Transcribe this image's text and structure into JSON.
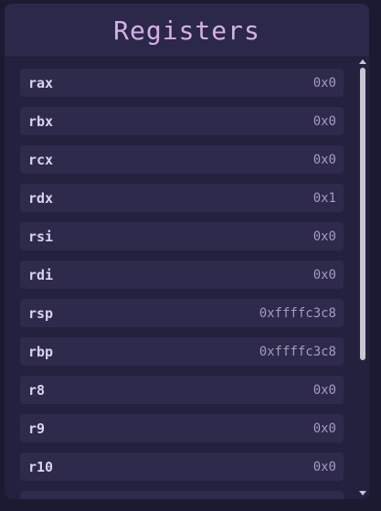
{
  "panel": {
    "title": "Registers"
  },
  "registers": [
    {
      "name": "rax",
      "value": "0x0"
    },
    {
      "name": "rbx",
      "value": "0x0"
    },
    {
      "name": "rcx",
      "value": "0x0"
    },
    {
      "name": "rdx",
      "value": "0x1"
    },
    {
      "name": "rsi",
      "value": "0x0"
    },
    {
      "name": "rdi",
      "value": "0x0"
    },
    {
      "name": "rsp",
      "value": "0xffffc3c8"
    },
    {
      "name": "rbp",
      "value": "0xffffc3c8"
    },
    {
      "name": "r8",
      "value": "0x0"
    },
    {
      "name": "r9",
      "value": "0x0"
    },
    {
      "name": "r10",
      "value": "0x0"
    },
    {
      "name": "",
      "value": ""
    }
  ],
  "colors": {
    "background": "#1c1a30",
    "panel": "#24213e",
    "row": "#2d2a4c",
    "title": "#d6b0e6"
  }
}
